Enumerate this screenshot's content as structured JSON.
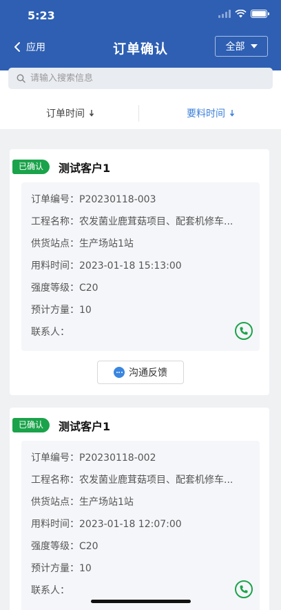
{
  "status_bar": {
    "time": "5:23"
  },
  "header": {
    "back_label": "应用",
    "title": "订单确认",
    "filter_label": "全部"
  },
  "search": {
    "placeholder": "请输入搜索信息"
  },
  "sort_tabs": [
    {
      "label": "订单时间",
      "active": false
    },
    {
      "label": "要料时间",
      "active": true
    }
  ],
  "orders": [
    {
      "status": "已确认",
      "client": "测试客户1",
      "order_no_label": "订单编号：",
      "order_no": "P20230118-003",
      "project_label": "工程名称：",
      "project": "农发菌业鹿茸菇项目、配套机修车...",
      "station_label": "供货站点：",
      "station": "生产场站1站",
      "time_label": "用料时间：",
      "time": "2023-01-18 15:13:00",
      "grade_label": "强度等级：",
      "grade": "C20",
      "volume_label": "预计方量：",
      "volume": "10",
      "contact_label": "联系人：",
      "contact": "",
      "feedback_label": "沟通反馈"
    },
    {
      "status": "已确认",
      "client": "测试客户1",
      "order_no_label": "订单编号：",
      "order_no": "P20230118-002",
      "project_label": "工程名称：",
      "project": "农发菌业鹿茸菇项目、配套机修车...",
      "station_label": "供货站点：",
      "station": "生产场站1站",
      "time_label": "用料时间：",
      "time": "2023-01-18 12:07:00",
      "grade_label": "强度等级：",
      "grade": "C20",
      "volume_label": "预计方量：",
      "volume": "10",
      "contact_label": "联系人：",
      "contact": ""
    }
  ],
  "colors": {
    "header_bg": "#2e5fb3",
    "status_green": "#1aa34a",
    "active_blue": "#3a7fd9"
  }
}
